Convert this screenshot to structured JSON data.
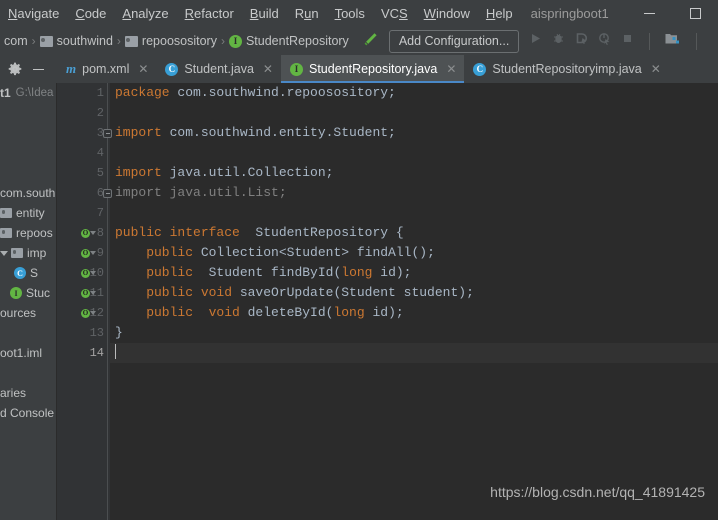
{
  "window": {
    "project_title": "aispringboot1",
    "minimize_label": "minimize",
    "maximize_label": "maximize"
  },
  "menubar": {
    "items": [
      {
        "label": "Navigate",
        "mnemonic": "N"
      },
      {
        "label": "Code",
        "mnemonic": "C"
      },
      {
        "label": "Analyze",
        "mnemonic": "A"
      },
      {
        "label": "Refactor",
        "mnemonic": "R"
      },
      {
        "label": "Build",
        "mnemonic": "B"
      },
      {
        "label": "Run",
        "mnemonic": "u"
      },
      {
        "label": "Tools",
        "mnemonic": "T"
      },
      {
        "label": "VCS",
        "mnemonic": "S"
      },
      {
        "label": "Window",
        "mnemonic": "W"
      },
      {
        "label": "Help",
        "mnemonic": "H"
      }
    ]
  },
  "navbar": {
    "breadcrumbs": [
      {
        "label": "com",
        "icon": "none"
      },
      {
        "label": "southwind",
        "icon": "folder-icon"
      },
      {
        "label": "repoosository",
        "icon": "folder-icon"
      },
      {
        "label": "StudentRepository",
        "icon": "interface-icon",
        "glyph": "I"
      }
    ],
    "separator": "›",
    "build_icon": "hammer-icon",
    "run_configuration": "Add Configuration...",
    "run_icons": [
      "run-icon",
      "debug-icon",
      "run-with-coverage-icon",
      "profile-icon",
      "stop-icon",
      "project-structure-icon"
    ]
  },
  "tabbar": {
    "tool_icons": [
      "gear-icon",
      "hide-icon"
    ],
    "tabs": [
      {
        "label": "pom.xml",
        "icon": "maven-icon",
        "glyph": "m",
        "active": false,
        "closable": true
      },
      {
        "label": "Student.java",
        "icon": "class-icon",
        "glyph": "C",
        "active": false,
        "closable": true
      },
      {
        "label": "StudentRepository.java",
        "icon": "interface-icon",
        "glyph": "I",
        "active": true,
        "closable": true
      },
      {
        "label": "StudentRepositoryimp.java",
        "icon": "class-icon",
        "glyph": "C",
        "active": false,
        "closable": true
      }
    ],
    "close_glyph": "✕"
  },
  "sidebar": {
    "rows": [
      {
        "text": "t1",
        "sub": "G:\\Idea",
        "type": "project-root",
        "bold": true
      },
      {
        "text": "",
        "type": "spacer"
      },
      {
        "text": "",
        "type": "spacer"
      },
      {
        "text": "",
        "type": "spacer"
      },
      {
        "text": "",
        "type": "spacer"
      },
      {
        "text": "com.south",
        "type": "package"
      },
      {
        "text": "entity",
        "type": "folder"
      },
      {
        "text": "repoos",
        "type": "folder"
      },
      {
        "text": "imp",
        "type": "folder-open"
      },
      {
        "text": "S",
        "type": "class",
        "glyph": "C"
      },
      {
        "text": "Stuc",
        "type": "interface",
        "glyph": "I"
      },
      {
        "text": "ources",
        "type": "plain"
      },
      {
        "text": "",
        "type": "spacer"
      },
      {
        "text": "oot1.iml",
        "type": "plain"
      },
      {
        "text": "",
        "type": "spacer"
      },
      {
        "text": "aries",
        "type": "plain"
      },
      {
        "text": "d Console",
        "type": "plain"
      }
    ]
  },
  "editor": {
    "lines": [
      {
        "n": "1",
        "marker": false,
        "fold": false,
        "current": false,
        "tokens": [
          {
            "t": "package ",
            "c": "kw"
          },
          {
            "t": "com.southwind.repoosository;",
            "c": "id"
          }
        ]
      },
      {
        "n": "2",
        "marker": false,
        "fold": false,
        "current": false,
        "tokens": []
      },
      {
        "n": "3",
        "marker": false,
        "fold": true,
        "current": false,
        "tokens": [
          {
            "t": "import ",
            "c": "kw"
          },
          {
            "t": "com.southwind.entity.Student;",
            "c": "id"
          }
        ]
      },
      {
        "n": "4",
        "marker": false,
        "fold": false,
        "current": false,
        "tokens": []
      },
      {
        "n": "5",
        "marker": false,
        "fold": false,
        "current": false,
        "tokens": [
          {
            "t": "import ",
            "c": "kw"
          },
          {
            "t": "java.util.Collection;",
            "c": "id"
          }
        ]
      },
      {
        "n": "6",
        "marker": false,
        "fold": true,
        "current": false,
        "tokens": [
          {
            "t": "import ",
            "c": "dim"
          },
          {
            "t": "java.util.List;",
            "c": "dim"
          }
        ]
      },
      {
        "n": "7",
        "marker": false,
        "fold": false,
        "current": false,
        "tokens": []
      },
      {
        "n": "8",
        "marker": true,
        "fold": false,
        "current": false,
        "tokens": [
          {
            "t": "public interface ",
            "c": "kw"
          },
          {
            "t": " StudentRepository {",
            "c": "id"
          }
        ]
      },
      {
        "n": "9",
        "marker": true,
        "fold": false,
        "current": false,
        "tokens": [
          {
            "t": "    public ",
            "c": "kw"
          },
          {
            "t": "Collection<Student> findAll();",
            "c": "id"
          }
        ]
      },
      {
        "n": "10",
        "marker": true,
        "fold": false,
        "current": false,
        "tokens": [
          {
            "t": "    public ",
            "c": "kw"
          },
          {
            "t": " Student findById(",
            "c": "id"
          },
          {
            "t": "long ",
            "c": "kw"
          },
          {
            "t": "id);",
            "c": "id"
          }
        ]
      },
      {
        "n": "11",
        "marker": true,
        "fold": false,
        "current": false,
        "tokens": [
          {
            "t": "    public void ",
            "c": "kw"
          },
          {
            "t": "saveOrUpdate(Student student);",
            "c": "id"
          }
        ]
      },
      {
        "n": "12",
        "marker": true,
        "fold": false,
        "current": false,
        "tokens": [
          {
            "t": "    public  void ",
            "c": "kw"
          },
          {
            "t": "deleteById(",
            "c": "id"
          },
          {
            "t": "long ",
            "c": "kw"
          },
          {
            "t": "id);",
            "c": "id"
          }
        ]
      },
      {
        "n": "13",
        "marker": false,
        "fold": false,
        "current": false,
        "tokens": [
          {
            "t": "}",
            "c": "id"
          }
        ]
      },
      {
        "n": "14",
        "marker": false,
        "fold": false,
        "current": true,
        "caret": true,
        "tokens": []
      }
    ]
  },
  "watermark": {
    "text": "https://blog.csdn.net/qq_41891425"
  },
  "colors": {
    "chrome_bg": "#3c3f41",
    "editor_bg": "#2b2b2b",
    "gutter_bg": "#313335",
    "keyword": "#cc7832",
    "identifier": "#a9b7c6",
    "dim_text": "#808080",
    "tab_active_underline": "#4a88c7",
    "interface_green": "#62b543",
    "class_blue": "#389fd6"
  }
}
